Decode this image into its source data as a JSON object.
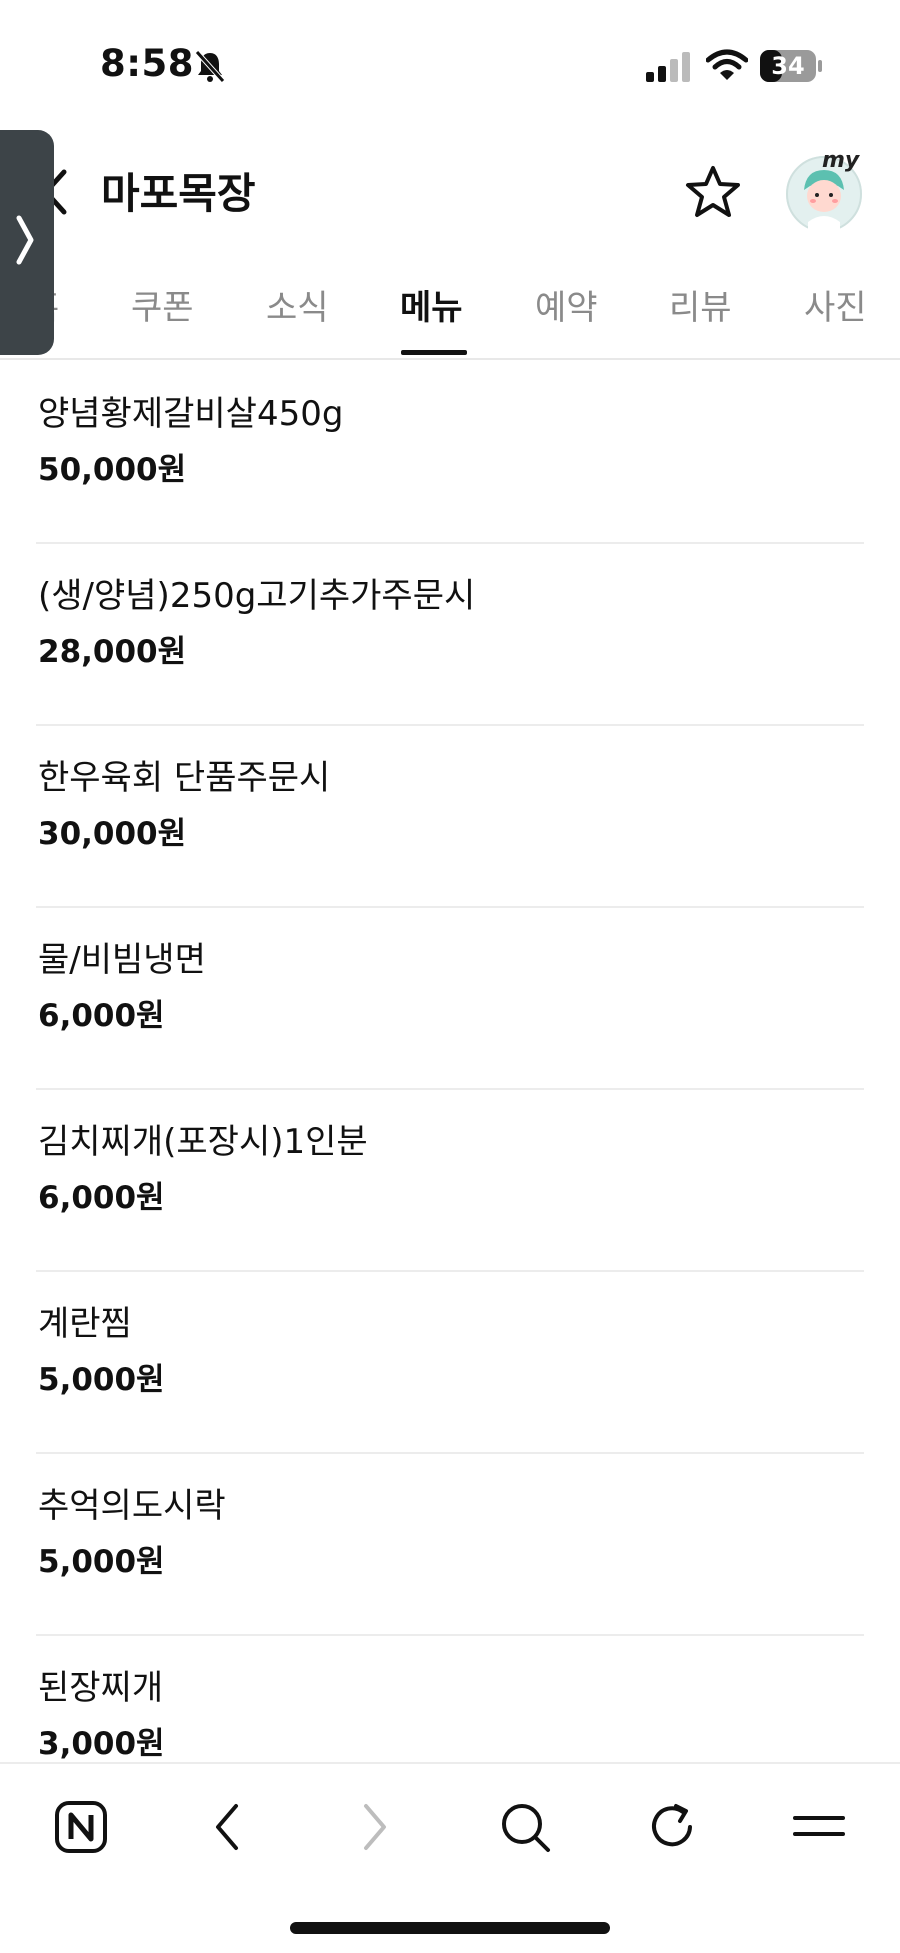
{
  "status_bar": {
    "time": "8:58",
    "battery": "34"
  },
  "header": {
    "title": "마포목장",
    "avatar_badge": "my"
  },
  "tabs": [
    {
      "label": "홈",
      "active": false
    },
    {
      "label": "쿠폰",
      "active": false
    },
    {
      "label": "소식",
      "active": false
    },
    {
      "label": "메뉴",
      "active": true
    },
    {
      "label": "예약",
      "active": false
    },
    {
      "label": "리뷰",
      "active": false
    },
    {
      "label": "사진",
      "active": false
    }
  ],
  "menu": [
    {
      "name": "양념황제갈비살450g",
      "price": "50,000원"
    },
    {
      "name": "(생/양념)250g고기추가주문시",
      "price": "28,000원"
    },
    {
      "name": "한우육회 단품주문시",
      "price": "30,000원"
    },
    {
      "name": "물/비빔냉면",
      "price": "6,000원"
    },
    {
      "name": "김치찌개(포장시)1인분",
      "price": "6,000원"
    },
    {
      "name": "계란찜",
      "price": "5,000원"
    },
    {
      "name": "추억의도시락",
      "price": "5,000원"
    },
    {
      "name": "된장찌개",
      "price": "3,000원"
    }
  ],
  "colors": {
    "accent_text": "#111111",
    "inactive_tab": "#8a8a8a",
    "side_handle": "#3d4448"
  }
}
